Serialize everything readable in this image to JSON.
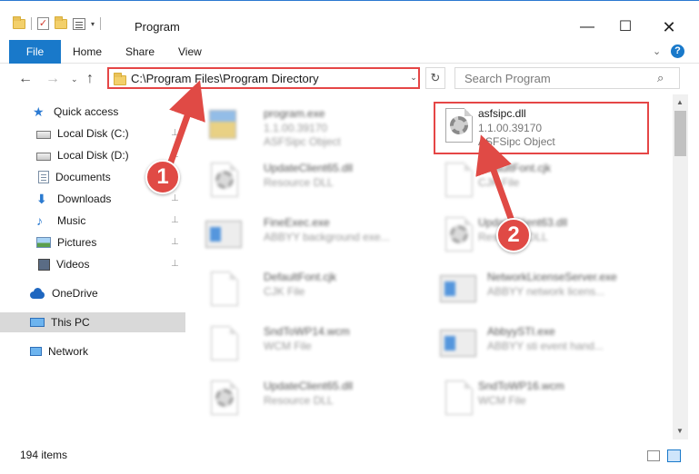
{
  "window": {
    "title": "Program",
    "controls": {
      "minimize": "—",
      "maximize": "☐",
      "close": "✕"
    }
  },
  "ribbon": {
    "file": "File",
    "tabs": [
      "Home",
      "Share",
      "View"
    ],
    "collapse": "⌄",
    "help": "?"
  },
  "nav": {
    "back": "←",
    "forward": "→",
    "recent": "⌄",
    "up": "↑",
    "address": "C:\\Program Files\\Program Directory",
    "refresh": "↻",
    "dropdown": "⌄",
    "search_placeholder": "Search Program",
    "search_icon": "⌕"
  },
  "sidebar": {
    "items": [
      {
        "label": "Quick access",
        "icon": "star-icon"
      },
      {
        "label": "Local Disk (C:)",
        "icon": "disk-icon",
        "pinned": true
      },
      {
        "label": "Local Disk (D:)",
        "icon": "disk-icon",
        "pinned": true
      },
      {
        "label": "Documents",
        "icon": "documents-icon",
        "pinned": true
      },
      {
        "label": "Downloads",
        "icon": "downloads-icon",
        "pinned": true
      },
      {
        "label": "Music",
        "icon": "music-icon",
        "pinned": true
      },
      {
        "label": "Pictures",
        "icon": "pictures-icon",
        "pinned": true
      },
      {
        "label": "Videos",
        "icon": "videos-icon",
        "pinned": true
      },
      {
        "label": "OneDrive",
        "icon": "onedrive-icon"
      },
      {
        "label": "This PC",
        "icon": "pc-icon",
        "selected": true
      },
      {
        "label": "Network",
        "icon": "network-icon"
      }
    ],
    "pin_glyph": "📌"
  },
  "files": [
    {
      "name": "program.exe",
      "meta1": "1.1.00.39170",
      "meta2": "ASFSipc Object",
      "icon": "program-icon",
      "blurred": true
    },
    {
      "name": "asfsipc.dll",
      "meta1": "1.1.00.39170",
      "meta2": "ASFSipc Object",
      "icon": "dll-gears-icon",
      "blurred": false
    },
    {
      "name": "UpdateClient65.dll",
      "meta1": "Resource DLL",
      "meta2": "",
      "icon": "dll-gears-icon",
      "blurred": true
    },
    {
      "name": "DefaultFont.cjk",
      "meta1": "CJK File",
      "meta2": "",
      "icon": "blank-file-icon",
      "blurred": true
    },
    {
      "name": "FineExec.exe",
      "meta1": "ABBYY background exe...",
      "meta2": "",
      "icon": "exe-icon",
      "blurred": true
    },
    {
      "name": "UpdateClient63.dll",
      "meta1": "Resource DLL",
      "meta2": "",
      "icon": "dll-gears-icon",
      "blurred": true
    },
    {
      "name": "DefaultFont.cjk",
      "meta1": "CJK File",
      "meta2": "",
      "icon": "blank-file-icon",
      "blurred": true
    },
    {
      "name": "NetworkLicenseServer.exe",
      "meta1": "ABBYY network licens...",
      "meta2": "",
      "icon": "exe-icon",
      "blurred": true
    },
    {
      "name": "SndToWP14.wcm",
      "meta1": "WCM File",
      "meta2": "",
      "icon": "blank-file-icon",
      "blurred": true
    },
    {
      "name": "AbbyySTI.exe",
      "meta1": "ABBYY sti event hand...",
      "meta2": "",
      "icon": "exe-icon",
      "blurred": true
    },
    {
      "name": "UpdateClient65.dll",
      "meta1": "Resource DLL",
      "meta2": "",
      "icon": "dll-gears-icon",
      "blurred": true
    },
    {
      "name": "SndToWP16.wcm",
      "meta1": "WCM File",
      "meta2": "",
      "icon": "blank-file-icon",
      "blurred": true
    }
  ],
  "callouts": {
    "one": "1",
    "two": "2"
  },
  "status": {
    "count": "194 items"
  },
  "colors": {
    "accent": "#1979ca",
    "highlight": "#e54646"
  }
}
